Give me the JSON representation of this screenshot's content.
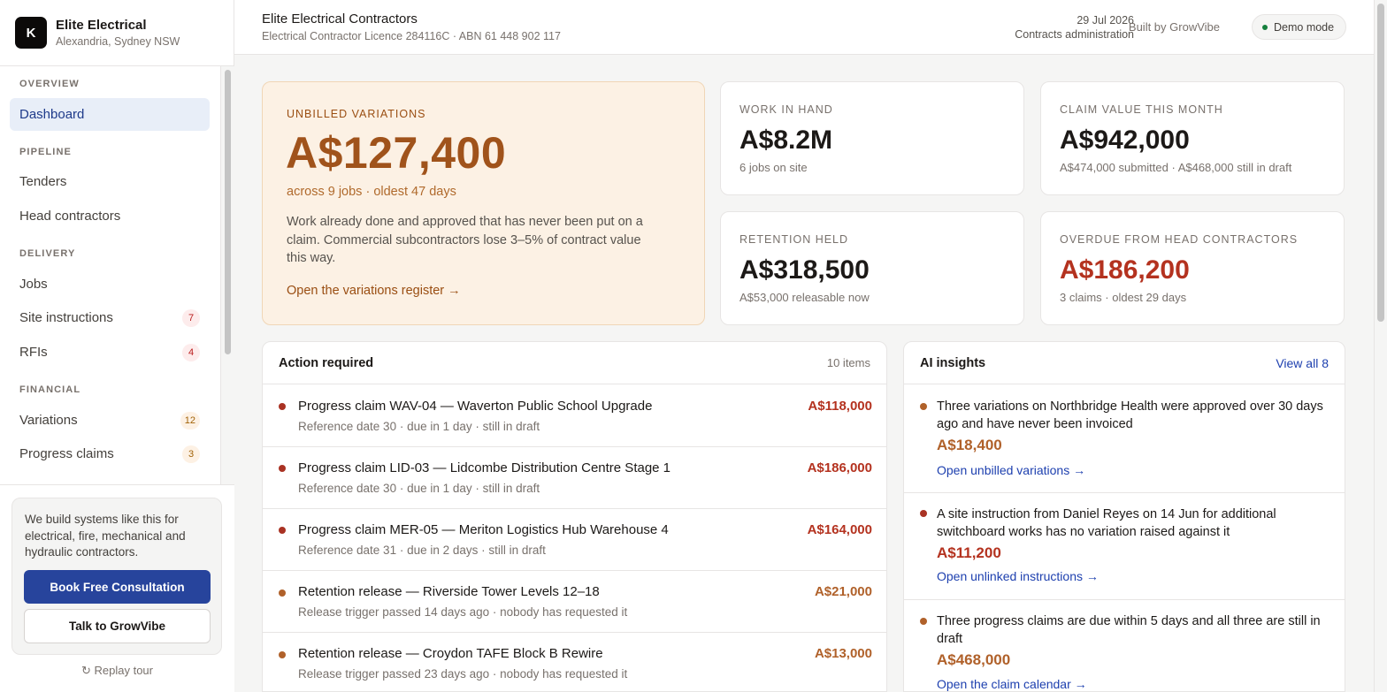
{
  "brand": {
    "logo_letter": "K",
    "name": "Elite Electrical",
    "location": "Alexandria, Sydney NSW"
  },
  "nav": {
    "sections": {
      "overview": "OVERVIEW",
      "pipeline": "PIPELINE",
      "delivery": "DELIVERY",
      "financial": "FINANCIAL"
    },
    "items": {
      "dashboard": "Dashboard",
      "tenders": "Tenders",
      "head_contractors": "Head contractors",
      "jobs": "Jobs",
      "site_instructions": {
        "label": "Site instructions",
        "badge": "7"
      },
      "rfis": {
        "label": "RFIs",
        "badge": "4"
      },
      "variations": {
        "label": "Variations",
        "badge": "12"
      },
      "progress_claims": {
        "label": "Progress claims",
        "badge": "3"
      }
    }
  },
  "promo": {
    "text": "We build systems like this for electrical, fire, mechanical and hydraulic contractors.",
    "primary_label": "Book Free Consultation",
    "secondary_label": "Talk to GrowVibe",
    "replay_label": "↻ Replay tour"
  },
  "header": {
    "company": "Elite Electrical Contractors",
    "licence": "Electrical Contractor Licence 284116C · ABN 61 448 902 117",
    "date": "29 Jul 2026",
    "role": "Contracts administration",
    "built_by": "Built by GrowVibe",
    "mode": "Demo mode"
  },
  "hero": {
    "label": "UNBILLED VARIATIONS",
    "value": "A$127,400",
    "sub": "across 9 jobs · oldest 47 days",
    "description": "Work already done and approved that has never been put on a claim. Commercial subcontractors lose 3–5% of contract value this way.",
    "link": "Open the variations register →"
  },
  "stats": {
    "work_in_hand": {
      "label": "WORK IN HAND",
      "value": "A$8.2M",
      "sub": "6 jobs on site"
    },
    "claim_value": {
      "label": "CLAIM VALUE THIS MONTH",
      "value": "A$942,000",
      "sub": "A$474,000 submitted · A$468,000 still in draft"
    },
    "retention": {
      "label": "RETENTION HELD",
      "value": "A$318,500",
      "sub": "A$53,000 releasable now"
    },
    "overdue": {
      "label": "OVERDUE FROM HEAD CONTRACTORS",
      "value": "A$186,200",
      "sub": "3 claims · oldest 29 days"
    }
  },
  "action_required": {
    "title": "Action required",
    "count": "10 items",
    "rows": [
      {
        "title": "Progress claim WAV-04 — Waverton Public School Upgrade",
        "sub": "Reference date 30 · due in 1 day · still in draft",
        "amount": "A$118,000",
        "severity": "red"
      },
      {
        "title": "Progress claim LID-03 — Lidcombe Distribution Centre Stage 1",
        "sub": "Reference date 30 · due in 1 day · still in draft",
        "amount": "A$186,000",
        "severity": "red"
      },
      {
        "title": "Progress claim MER-05 — Meriton Logistics Hub Warehouse 4",
        "sub": "Reference date 31 · due in 2 days · still in draft",
        "amount": "A$164,000",
        "severity": "red"
      },
      {
        "title": "Retention release — Riverside Tower Levels 12–18",
        "sub": "Release trigger passed 14 days ago · nobody has requested it",
        "amount": "A$21,000",
        "severity": "amber"
      },
      {
        "title": "Retention release — Croydon TAFE Block B Rewire",
        "sub": "Release trigger passed 23 days ago · nobody has requested it",
        "amount": "A$13,000",
        "severity": "amber"
      }
    ]
  },
  "ai_insights": {
    "title": "AI insights",
    "view_all": "View all 8",
    "rows": [
      {
        "text": "Three variations on Northbridge Health were approved over 30 days ago and have never been invoiced",
        "amount": "A$18,400",
        "link": "Open unbilled variations →",
        "severity": "amber"
      },
      {
        "text": "A site instruction from Daniel Reyes on 14 Jun for additional switchboard works has no variation raised against it",
        "amount": "A$11,200",
        "link": "Open unlinked instructions →",
        "severity": "red"
      },
      {
        "text": "Three progress claims are due within 5 days and all three are still in draft",
        "amount": "A$468,000",
        "link": "Open the claim calendar →",
        "severity": "amber"
      }
    ]
  },
  "colors": {
    "accent": "#27449c",
    "warning": "#b0612a",
    "danger": "#b4321f"
  }
}
